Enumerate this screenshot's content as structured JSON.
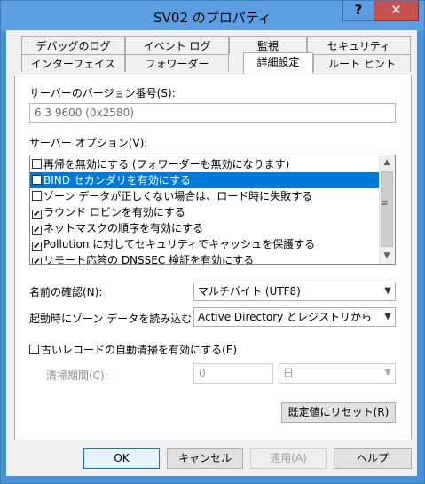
{
  "window": {
    "title": "SV02 のプロパティ",
    "help_label": "?",
    "close_label": "✕"
  },
  "tabs_row1": [
    "デバッグのログ",
    "イベント ログ",
    "監視",
    "セキュリティ"
  ],
  "tabs_row2": [
    "インターフェイス",
    "フォワーダー",
    "詳細設定",
    "ルート ヒント"
  ],
  "active_tab": "詳細設定",
  "server_version": {
    "label": "サーバーのバージョン番号(S):",
    "value": "6.3 9600 (0x2580)"
  },
  "server_options": {
    "label": "サーバー オプション(V):",
    "items": [
      {
        "label": "再帰を無効にする (フォワーダーも無効になります)",
        "checked": false,
        "selected": false
      },
      {
        "label": "BIND セカンダリを有効にする",
        "checked": false,
        "selected": true
      },
      {
        "label": "ゾーン データが正しくない場合は、ロード時に失敗する",
        "checked": false,
        "selected": false
      },
      {
        "label": "ラウンド ロビンを有効にする",
        "checked": true,
        "selected": false
      },
      {
        "label": "ネットマスクの順序を有効にする",
        "checked": true,
        "selected": false
      },
      {
        "label": "Pollution に対してセキュリティでキャッシュを保護する",
        "checked": true,
        "selected": false
      },
      {
        "label": "リモート応答の DNSSEC 検証を有効にする",
        "checked": true,
        "selected": false
      }
    ]
  },
  "name_check": {
    "label": "名前の確認(N):",
    "value": "マルチバイト (UTF8)"
  },
  "load_zone": {
    "label": "起動時にゾーン データを読み込む(L):",
    "value": "Active Directory とレジストリから"
  },
  "scavenging": {
    "label": "古いレコードの自動清掃を有効にする(E)",
    "checked": false,
    "period_label": "清掃期間(C):",
    "period_value": "0",
    "period_unit": "日"
  },
  "reset_button": "既定値にリセット(R)",
  "footer": {
    "ok": "OK",
    "cancel": "キャンセル",
    "apply": "適用(A)",
    "help": "ヘルプ"
  }
}
